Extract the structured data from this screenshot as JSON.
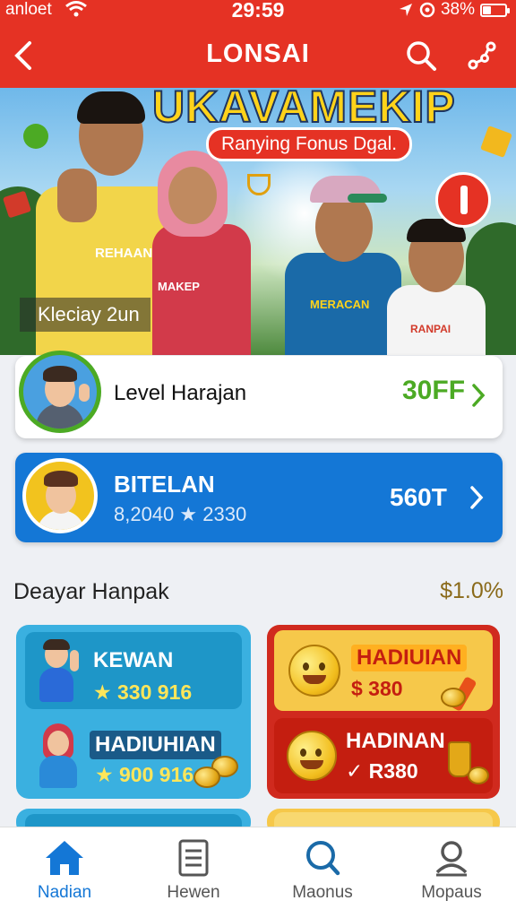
{
  "status_bar": {
    "carrier": "anloet",
    "time": "29:59",
    "battery": "38%",
    "battery_level": 0.38
  },
  "header": {
    "title": "LONSAI"
  },
  "hero": {
    "title": "UKAVAMEKIP",
    "subtitle": "Ranying Fonus Dgal.",
    "caption": "Kleciay 2un",
    "shirt_1": "REHAAN",
    "shirt_2": "MAKEP",
    "shirt_3": "MERACAN",
    "shirt_4": "RANPAI"
  },
  "level_card": {
    "label": "Level Harajan",
    "value": "30FF"
  },
  "user_card": {
    "name": "BITELAN",
    "stats": "8,2040 ★ 2330",
    "value": "560T"
  },
  "section": {
    "title": "Deayar Hanpak",
    "right": "$1.0%"
  },
  "rewards": [
    {
      "label": "KEWAN",
      "value": "★ 330 916"
    },
    {
      "label": "HADIUHIAN",
      "value": "★ 900 916"
    },
    {
      "label": "HADIUIAN",
      "value": "$ 380"
    },
    {
      "label": "HADINAN",
      "value": "✓ R380"
    }
  ],
  "nav": [
    {
      "label": "Nadian",
      "icon": "home-icon",
      "active": true
    },
    {
      "label": "Hewen",
      "icon": "document-icon",
      "active": false
    },
    {
      "label": "Maonus",
      "icon": "search-icon",
      "active": false
    },
    {
      "label": "Mopaus",
      "icon": "profile-icon",
      "active": false
    }
  ],
  "colors": {
    "brand_red": "#e53224",
    "brand_blue": "#1477d6",
    "accent_green": "#4caa24",
    "nav_active": "#1477d6"
  }
}
